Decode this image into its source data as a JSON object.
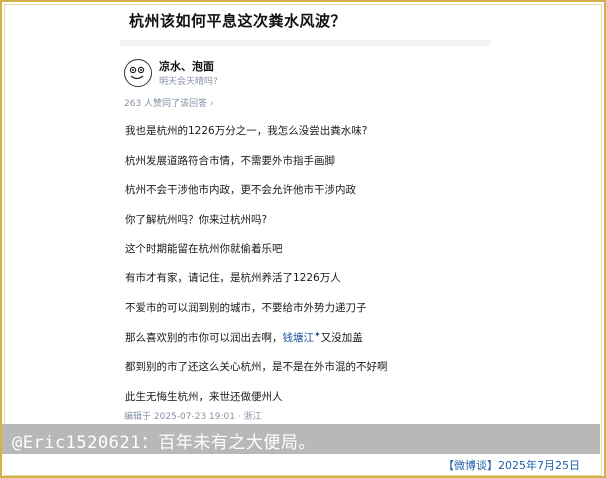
{
  "question": {
    "title": "杭州该如何平息这次粪水风波？"
  },
  "author": {
    "name": "凉水、泡面",
    "bio": "明天会天晴吗?"
  },
  "stats": {
    "likes": "263 人赞同了该回答 ›"
  },
  "answer": {
    "lines": [
      "我也是杭州的1226万分之一，我怎么没尝出粪水味?",
      "杭州发展道路符合市情，不需要外市指手画脚",
      "杭州不会干涉他市内政，更不会允许他市干涉内政",
      "你了解杭州吗？你来过杭州吗?",
      "这个时期能留在杭州你就偷着乐吧",
      "有市才有家，请记住，是杭州养活了1226万人",
      "不爱市的可以润到别的城市，不要给市外势力递刀子"
    ],
    "line_link": {
      "before": "那么喜欢别的市你可以润出去啊，",
      "link": "钱塘江",
      "mark": "✦",
      "after": "又没加盖"
    },
    "lines_after": [
      "都到别的市了还这么关心杭州，是不是在外市混的不好啊",
      "此生无悔生杭州，来世还做便州人"
    ],
    "meta": "编辑于 2025-07-23 19:01 · 浙江"
  },
  "caption": {
    "text": "@Eric1520621：百年未有之大便局。"
  },
  "source": {
    "text": "【微博谈】2025年7月25日"
  }
}
